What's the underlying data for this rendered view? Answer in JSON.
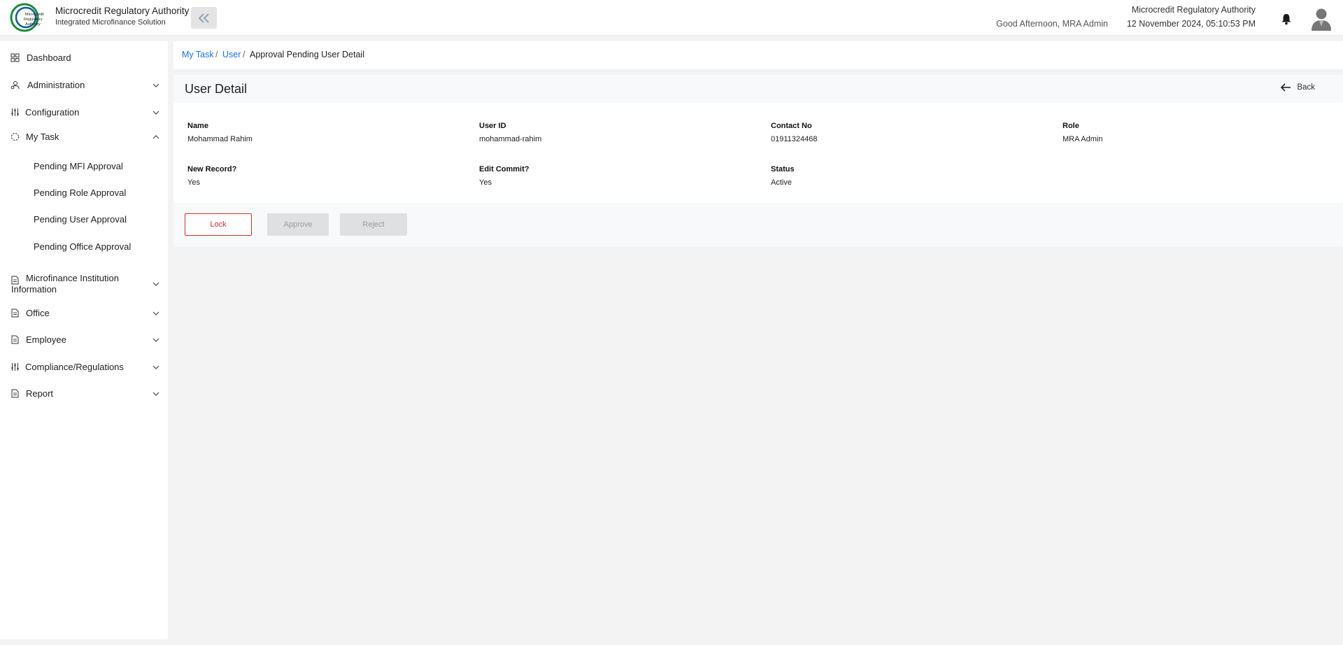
{
  "header": {
    "logo_text": "Microcredit Regulatory Authority",
    "title": "Microcredit Regulatory Authority",
    "subtitle": "Integrated Microfinance Solution",
    "greeting": "Good Afternoon, MRA Admin",
    "org_name": "Microcredit Regulatory Authority",
    "datetime": "12 November 2024, 05:10:53 PM",
    "collapse_icon": "double-chevron-left-icon",
    "bell_icon": "bell-icon",
    "avatar_icon": "user-avatar-icon"
  },
  "sidebar": {
    "items": [
      {
        "label": "Dashboard",
        "icon": "grid-icon"
      },
      {
        "label": "Administration",
        "icon": "admin-icon"
      },
      {
        "label": "Configuration",
        "icon": "sliders-icon"
      },
      {
        "label": "My Task",
        "icon": "task-icon"
      },
      {
        "label": "Microfinance Institution Information",
        "icon": "document-icon"
      },
      {
        "label": "Office",
        "icon": "document-icon"
      },
      {
        "label": "Employee",
        "icon": "document-icon"
      },
      {
        "label": "Compliance/Regulations",
        "icon": "sliders-icon"
      },
      {
        "label": "Report",
        "icon": "document-icon"
      }
    ],
    "my_task_sub": [
      "Pending MFI Approval",
      "Pending Role Approval",
      "Pending User Approval",
      "Pending Office Approval"
    ]
  },
  "breadcrumb": {
    "items": [
      "My Task",
      "User",
      "Approval Pending User Detail"
    ],
    "separator": "/"
  },
  "detail": {
    "title": "User Detail",
    "back_label": "Back",
    "fields": [
      {
        "label": "Name",
        "value": "Mohammad Rahim"
      },
      {
        "label": "User ID",
        "value": "mohammad-rahim"
      },
      {
        "label": "Contact No",
        "value": "01911324468"
      },
      {
        "label": "Role",
        "value": "MRA Admin"
      },
      {
        "label": "New Record?",
        "value": "Yes"
      },
      {
        "label": "Edit Commit?",
        "value": "Yes"
      },
      {
        "label": "Status",
        "value": "Active"
      }
    ],
    "actions": {
      "lock": "Lock",
      "approve": "Approve",
      "reject": "Reject"
    }
  },
  "colors": {
    "link": "#1a73e8",
    "lock": "#d32f2f",
    "disabled_bg": "#e0e0e0",
    "logo_green": "#1b8a3e"
  }
}
